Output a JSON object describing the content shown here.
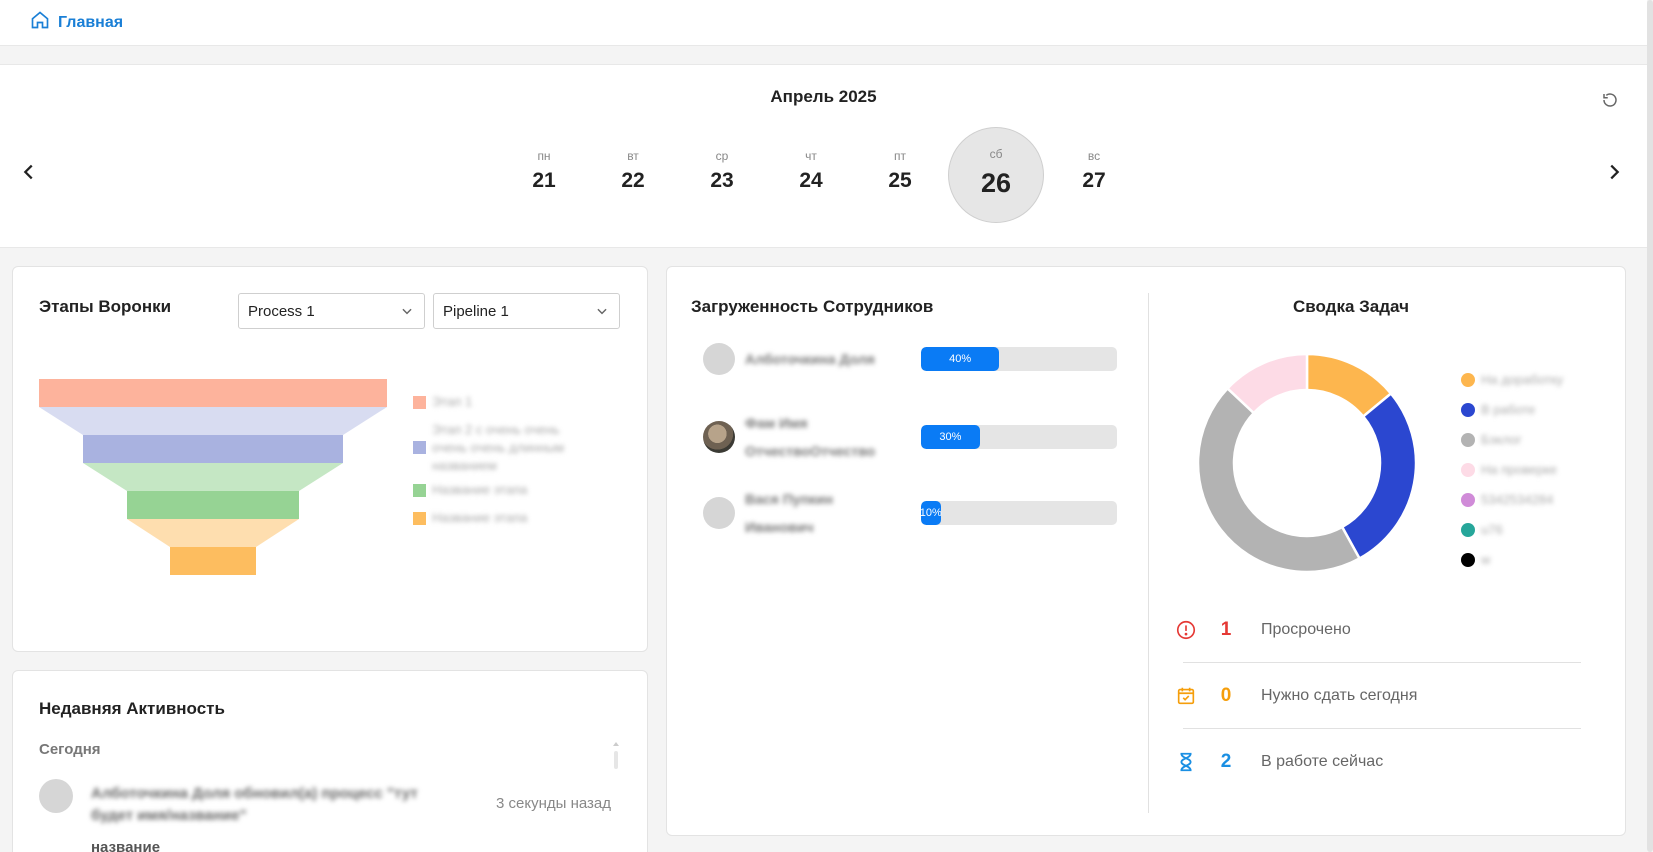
{
  "topbar": {
    "home_label": "Главная"
  },
  "calendar": {
    "title": "Апрель 2025",
    "days": [
      {
        "dow": "пн",
        "num": "21"
      },
      {
        "dow": "вт",
        "num": "22"
      },
      {
        "dow": "ср",
        "num": "23"
      },
      {
        "dow": "чт",
        "num": "24"
      },
      {
        "dow": "пт",
        "num": "25"
      },
      {
        "dow": "сб",
        "num": "26",
        "selected": true
      },
      {
        "dow": "вс",
        "num": "27"
      }
    ]
  },
  "funnel": {
    "title": "Этапы Воронки",
    "process_select": "Process 1",
    "pipeline_select": "Pipeline 1",
    "stages": [
      {
        "label": "Этап 1",
        "color": "#fdb39c"
      },
      {
        "label": "Этап 2 с очень очень очень очень длинным названием",
        "color": "#a9b2e0"
      },
      {
        "label": "Название этапа",
        "color": "#96d394"
      },
      {
        "label": "Название этапа",
        "color": "#fdbd5f"
      }
    ]
  },
  "activity": {
    "title": "Недавняя Активность",
    "group_today": "Сегодня",
    "items": [
      {
        "text": "Алботочкина Доля обновил(а) процесс \"тут будет имя/название\"",
        "time": "3 секунды назад",
        "sub": "название"
      }
    ]
  },
  "load": {
    "title": "Загруженность Сотрудников",
    "employees": [
      {
        "name": "Алботочкина Доля",
        "percent": 40,
        "percent_label": "40%",
        "avatar": "placeholder"
      },
      {
        "name": "Фам Имя ОтчествоОтчество",
        "percent": 30,
        "percent_label": "30%",
        "avatar": "photo"
      },
      {
        "name": "Вася Пупкин Иванович",
        "percent": 10,
        "percent_label": "10%",
        "avatar": "placeholder"
      }
    ]
  },
  "summary": {
    "title": "Сводка Задач",
    "legend": [
      {
        "label": "На доработку",
        "color": "#fdb64e"
      },
      {
        "label": "В работе",
        "color": "#2b47d0"
      },
      {
        "label": "Бэклог",
        "color": "#b3b3b3"
      },
      {
        "label": "На проверке",
        "color": "#fddbe6"
      },
      {
        "label": "5342534284",
        "color": "#d08bd8"
      },
      {
        "label": "u76",
        "color": "#26a69a"
      },
      {
        "label": "w",
        "color": "#000000"
      }
    ],
    "donut_values": [
      14,
      28,
      45,
      13
    ],
    "stats": [
      {
        "num": "1",
        "label": "Просрочено",
        "color": "#e53935",
        "icon": "alert-circle-icon"
      },
      {
        "num": "0",
        "label": "Нужно сдать сегодня",
        "color": "#f59e0b",
        "icon": "calendar-check-icon"
      },
      {
        "num": "2",
        "label": "В работе сейчас",
        "color": "#1a8fe3",
        "icon": "hourglass-icon"
      }
    ]
  }
}
